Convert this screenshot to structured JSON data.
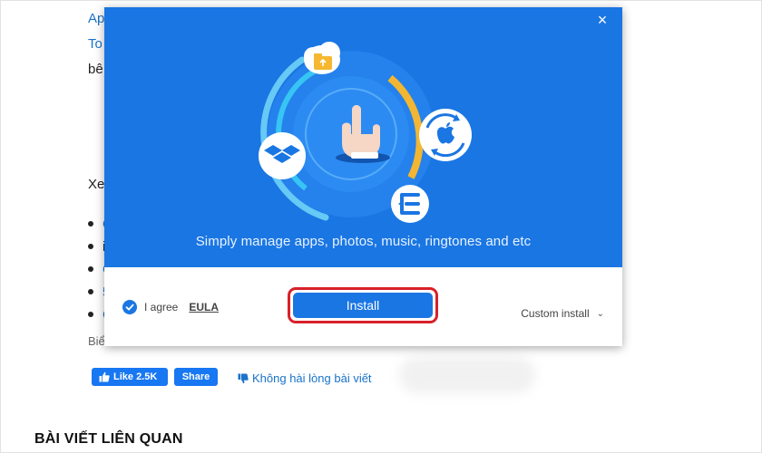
{
  "article": {
    "link1": "Ap",
    "link2": "To",
    "text1": "bê",
    "text2": "Xe",
    "bullets": [
      "C",
      "i",
      "C",
      "5",
      "C"
    ],
    "caption": "Biể",
    "like_label": "Like 2.5K",
    "share_label": "Share",
    "dislike_label": "Không hài lòng bài viết",
    "related_heading": "BÀI VIẾT LIÊN QUAN"
  },
  "dialog": {
    "close_icon": "×",
    "caption": "Simply manage apps, photos, music, ringtones and etc",
    "agree_label": "I agree",
    "eula_label": "EULA",
    "install_label": "Install",
    "custom_install_label": "Custom install",
    "chevron": "⌄"
  },
  "colors": {
    "hero_blue": "#1a76e3",
    "highlight_red": "#d8202a",
    "link_blue": "#1a73c8",
    "facebook_blue": "#1877f2",
    "ring_yellow": "#f2b632",
    "ring_cyan": "#2fd0f5"
  },
  "icons": [
    "close-icon",
    "cloud-folder-icon",
    "hand-pointer-icon",
    "dropbox-icon",
    "apple-sync-icon",
    "e-logo-icon",
    "check-icon",
    "thumbs-up-icon",
    "thumbs-down-icon",
    "chevron-down-icon"
  ]
}
